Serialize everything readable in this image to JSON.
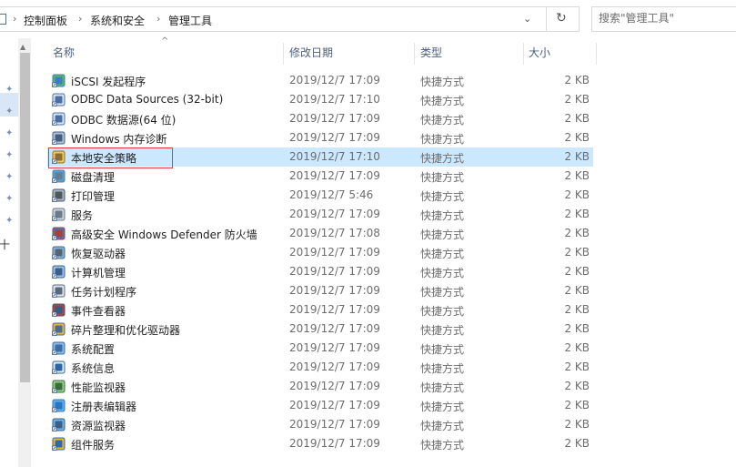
{
  "breadcrumb": {
    "items": [
      "控制面板",
      "系统和安全",
      "管理工具"
    ],
    "separator": "›"
  },
  "address": {
    "dropdown": "⌄",
    "refresh": "↻"
  },
  "search": {
    "placeholder": "搜索\"管理工具\""
  },
  "nav": {
    "partial_label": "十"
  },
  "columns": {
    "name": "名称",
    "date": "修改日期",
    "type": "类型",
    "size": "大小"
  },
  "files": [
    {
      "name": "iSCSI 发起程序",
      "date": "2019/12/7 17:09",
      "type": "快捷方式",
      "size": "2 KB",
      "icon": "iscsi-icon"
    },
    {
      "name": "ODBC Data Sources (32-bit)",
      "date": "2019/12/7 17:10",
      "type": "快捷方式",
      "size": "2 KB",
      "icon": "odbc-icon"
    },
    {
      "name": "ODBC 数据源(64 位)",
      "date": "2019/12/7 17:09",
      "type": "快捷方式",
      "size": "2 KB",
      "icon": "odbc-icon"
    },
    {
      "name": "Windows 内存诊断",
      "date": "2019/12/7 17:09",
      "type": "快捷方式",
      "size": "2 KB",
      "icon": "memory-diagnostic-icon"
    },
    {
      "name": "本地安全策略",
      "date": "2019/12/7 17:10",
      "type": "快捷方式",
      "size": "2 KB",
      "icon": "security-policy-icon",
      "selected": true
    },
    {
      "name": "磁盘清理",
      "date": "2019/12/7 17:09",
      "type": "快捷方式",
      "size": "2 KB",
      "icon": "disk-cleanup-icon"
    },
    {
      "name": "打印管理",
      "date": "2019/12/7 5:46",
      "type": "快捷方式",
      "size": "2 KB",
      "icon": "print-management-icon"
    },
    {
      "name": "服务",
      "date": "2019/12/7 17:09",
      "type": "快捷方式",
      "size": "2 KB",
      "icon": "services-icon"
    },
    {
      "name": "高级安全 Windows Defender 防火墙",
      "date": "2019/12/7 17:08",
      "type": "快捷方式",
      "size": "2 KB",
      "icon": "firewall-icon"
    },
    {
      "name": "恢复驱动器",
      "date": "2019/12/7 17:09",
      "type": "快捷方式",
      "size": "2 KB",
      "icon": "recovery-drive-icon"
    },
    {
      "name": "计算机管理",
      "date": "2019/12/7 17:09",
      "type": "快捷方式",
      "size": "2 KB",
      "icon": "computer-management-icon"
    },
    {
      "name": "任务计划程序",
      "date": "2019/12/7 17:09",
      "type": "快捷方式",
      "size": "2 KB",
      "icon": "task-scheduler-icon"
    },
    {
      "name": "事件查看器",
      "date": "2019/12/7 17:09",
      "type": "快捷方式",
      "size": "2 KB",
      "icon": "event-viewer-icon"
    },
    {
      "name": "碎片整理和优化驱动器",
      "date": "2019/12/7 17:09",
      "type": "快捷方式",
      "size": "2 KB",
      "icon": "defrag-icon"
    },
    {
      "name": "系统配置",
      "date": "2019/12/7 17:09",
      "type": "快捷方式",
      "size": "2 KB",
      "icon": "system-config-icon"
    },
    {
      "name": "系统信息",
      "date": "2019/12/7 17:09",
      "type": "快捷方式",
      "size": "2 KB",
      "icon": "system-info-icon"
    },
    {
      "name": "性能监视器",
      "date": "2019/12/7 17:09",
      "type": "快捷方式",
      "size": "2 KB",
      "icon": "performance-monitor-icon"
    },
    {
      "name": "注册表编辑器",
      "date": "2019/12/7 17:09",
      "type": "快捷方式",
      "size": "2 KB",
      "icon": "registry-editor-icon"
    },
    {
      "name": "资源监视器",
      "date": "2019/12/7 17:09",
      "type": "快捷方式",
      "size": "2 KB",
      "icon": "resource-monitor-icon"
    },
    {
      "name": "组件服务",
      "date": "2019/12/7 17:09",
      "type": "快捷方式",
      "size": "2 KB",
      "icon": "component-services-icon"
    }
  ],
  "colors": {
    "selection": "#cce8ff",
    "highlight_box": "#e0383e",
    "header_text": "#4c607a"
  }
}
